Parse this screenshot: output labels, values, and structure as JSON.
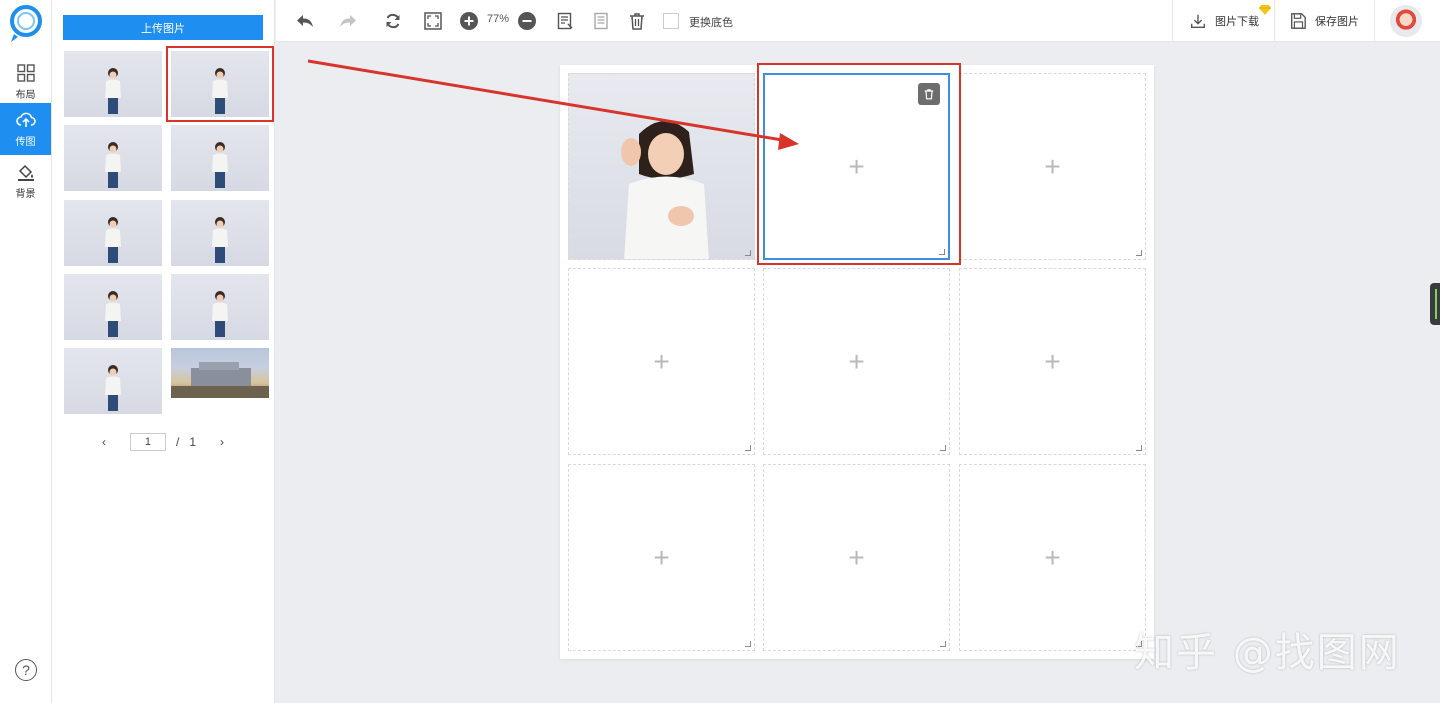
{
  "rail": {
    "items": [
      {
        "label": "布局",
        "icon": "grid-icon"
      },
      {
        "label": "传图",
        "icon": "cloud-upload-icon"
      },
      {
        "label": "背景",
        "icon": "paint-bucket-icon"
      }
    ],
    "help": "?"
  },
  "panel": {
    "upload_label": "上传图片",
    "thumbnails": [
      {
        "subject": "girl-photo"
      },
      {
        "subject": "girl-photo"
      },
      {
        "subject": "girl-photo"
      },
      {
        "subject": "girl-photo"
      },
      {
        "subject": "girl-photo"
      },
      {
        "subject": "girl-photo"
      },
      {
        "subject": "girl-photo"
      },
      {
        "subject": "girl-photo"
      },
      {
        "subject": "girl-photo"
      },
      {
        "subject": "landscape-photo"
      }
    ],
    "pager": {
      "current": "1",
      "separator": "/",
      "total": "1",
      "prev": "‹",
      "next": "›"
    }
  },
  "toolbar": {
    "undo": "undo-icon",
    "redo": "redo-icon",
    "refresh": "refresh-icon",
    "fit": "fit-screen-icon",
    "zoom_in": "zoom-in-icon",
    "zoom_level": "77%",
    "zoom_out": "zoom-out-icon",
    "bg_color_label": "更换底色",
    "download_label": "图片下载",
    "save_label": "保存图片"
  },
  "canvas": {
    "cells": [
      {
        "state": "filled"
      },
      {
        "state": "active-empty"
      },
      {
        "state": "empty"
      },
      {
        "state": "empty"
      },
      {
        "state": "empty"
      },
      {
        "state": "empty"
      },
      {
        "state": "empty"
      },
      {
        "state": "empty"
      },
      {
        "state": "empty"
      }
    ],
    "plus": "+"
  },
  "watermark": "知乎 @找图网",
  "colors": {
    "accent": "#1e8ff0",
    "highlight": "#d9342b",
    "active_cell": "#3d8fe0"
  }
}
